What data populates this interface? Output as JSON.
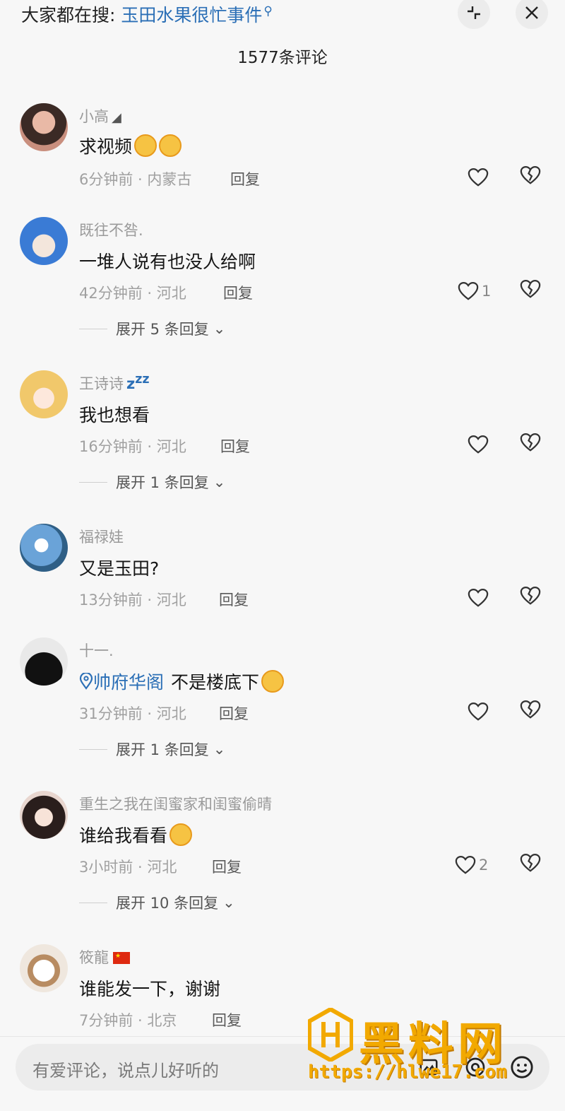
{
  "header": {
    "search_prefix": "大家都在搜:",
    "search_keyword": "玉田水果很忙事件",
    "comment_count_title": "1577条评论"
  },
  "comments": [
    {
      "user": "小高",
      "text": "求视频",
      "time": "6分钟前 · 内蒙古",
      "reply": "回复",
      "likes": ""
    },
    {
      "user": "既往不咎.",
      "text": "一堆人说有也没人给啊",
      "time": "42分钟前 · 河北",
      "reply": "回复",
      "likes": "1",
      "expand": "展开 5 条回复"
    },
    {
      "user": "王诗诗",
      "text": "我也想看",
      "time": "16分钟前 · 河北",
      "reply": "回复",
      "likes": "",
      "expand": "展开 1 条回复"
    },
    {
      "user": "福禄娃",
      "text": "又是玉田?",
      "time": "13分钟前 · 河北",
      "reply": "回复",
      "likes": ""
    },
    {
      "user": "十一.",
      "location_tag": "帅府华阁",
      "text": "不是楼底下",
      "time": "31分钟前 · 河北",
      "reply": "回复",
      "likes": "",
      "expand": "展开 1 条回复"
    },
    {
      "user": "重生之我在闺蜜家和闺蜜偷晴",
      "text": "谁给我看看",
      "time": "3小时前 · 河北",
      "reply": "回复",
      "likes": "2",
      "expand": "展开 10 条回复"
    },
    {
      "user": "筱龍",
      "text": "谁能发一下，谢谢",
      "time": "7分钟前 · 北京",
      "reply": "回复",
      "likes": ""
    }
  ],
  "input": {
    "placeholder": "有爱评论，说点儿好听的"
  },
  "watermark": {
    "text": "黑料网",
    "url": "https://hlwe17.com"
  },
  "colors": {
    "accent": "#2b6fb6",
    "watermark": "#f2a900"
  }
}
